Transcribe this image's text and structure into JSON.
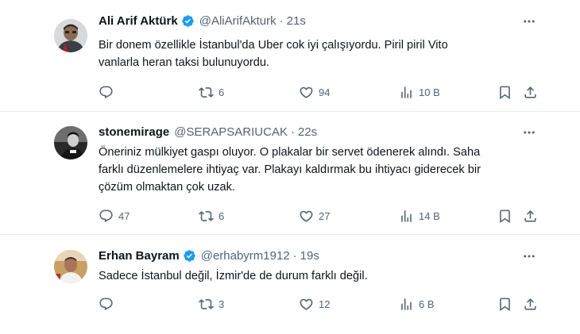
{
  "tweets": [
    {
      "name": "Ali Arif Aktürk",
      "verified": true,
      "handle": "@AliArifAkturk",
      "time": "21s",
      "text_lines": [
        "Bir donem özellikle İstanbul'da Uber cok iyi çalışıyordu. Piril piril Vito",
        "vanlarla heran taksi bulunuyordu."
      ],
      "replies": "",
      "retweets": "6",
      "likes": "94",
      "views": "10 B"
    },
    {
      "name": "stonemirage",
      "verified": false,
      "handle": "@SERAPSARIUCAK",
      "time": "22s",
      "text_lines": [
        "Öneriniz mülkiyet gaspı oluyor. O plakalar bir servet ödenerek alındı. Saha",
        "farklı düzenlemelere ihtiyaç var. Plakayı kaldırmak bu ihtiyacı giderecek bir",
        "çözüm olmaktan çok uzak."
      ],
      "replies": "47",
      "retweets": "6",
      "likes": "27",
      "views": "14 B"
    },
    {
      "name": "Erhan Bayram",
      "verified": true,
      "handle": "@erhabyrm1912",
      "time": "19s",
      "text_lines": [
        "Sadece İstanbul değil, İzmir'de de durum farklı değil."
      ],
      "replies": "",
      "retweets": "3",
      "likes": "12",
      "views": "6 B"
    }
  ],
  "separator": "·",
  "icons": {
    "verified": "verified-badge-icon",
    "more": "more-options-icon",
    "reply": "reply-icon",
    "retweet": "retweet-icon",
    "like": "like-icon",
    "views": "views-icon",
    "bookmark": "bookmark-icon",
    "share": "share-icon"
  },
  "colors": {
    "text": "#0f1419",
    "secondary": "#536471",
    "verified": "#1d9bf0",
    "divider": "#e6ecf0"
  }
}
